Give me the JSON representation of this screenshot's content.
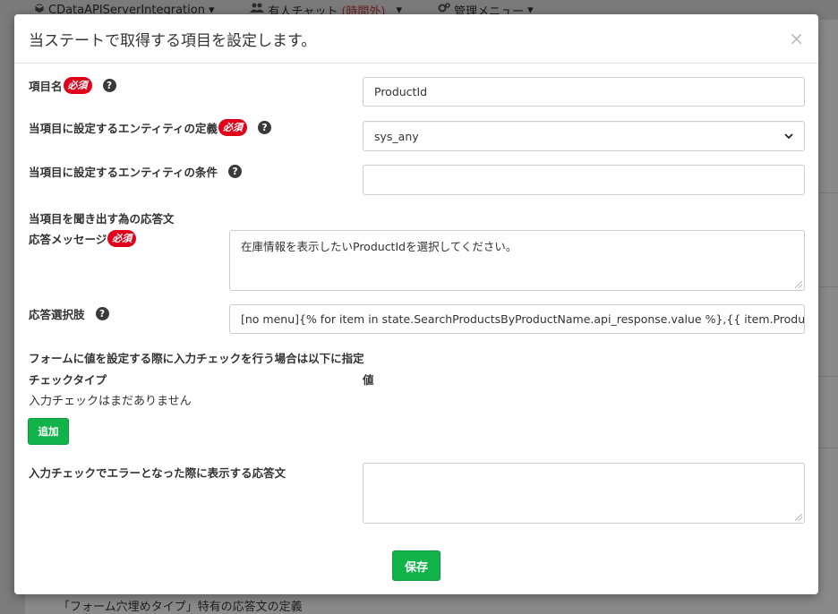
{
  "topnav": {
    "items": [
      {
        "icon": "cube-icon",
        "label": "CDataAPIServerIntegration",
        "caret": "▾"
      },
      {
        "icon": "users-icon",
        "label": "有人チャット",
        "status": "(時間外)",
        "caret": "▾"
      },
      {
        "icon": "gears-icon",
        "label": "管理メニュー",
        "caret": "▾"
      }
    ]
  },
  "background": {
    "footer_text": "「フォーム穴埋めタイプ」特有の応答文の定義"
  },
  "modal": {
    "title": "当ステートで取得する項目を設定します。",
    "close_glyph": "×",
    "required_badge": "必須",
    "help_glyph": "?",
    "fields": {
      "item_name": {
        "label": "項目名",
        "value": "ProductId"
      },
      "entity_definition": {
        "label": "当項目に設定するエンティティの定義",
        "value": "sys_any"
      },
      "entity_condition": {
        "label": "当項目に設定するエンティティの条件",
        "value": ""
      },
      "response_section": {
        "label": "当項目を聞き出す為の応答文"
      },
      "response_message": {
        "label": "応答メッセージ",
        "value": "在庫情報を表示したいProductIdを選択してください。"
      },
      "response_options": {
        "label": "応答選択肢",
        "value": "[no menu]{% for item in state.SearchProductsByProductName.api_response.value %},{{ item.ProductID }}"
      }
    },
    "validation": {
      "heading": "フォームに値を設定する際に入力チェックを行う場合は以下に指定",
      "col_check_type": "チェックタイプ",
      "col_value": "値",
      "empty_text": "入力チェックはまだありません",
      "add_button": "追加",
      "error_label": "入力チェックでエラーとなった際に表示する応答文",
      "error_value": ""
    },
    "save_button": "保存"
  },
  "colors": {
    "accent_green": "#12b34a",
    "required_red": "#e0001a"
  }
}
